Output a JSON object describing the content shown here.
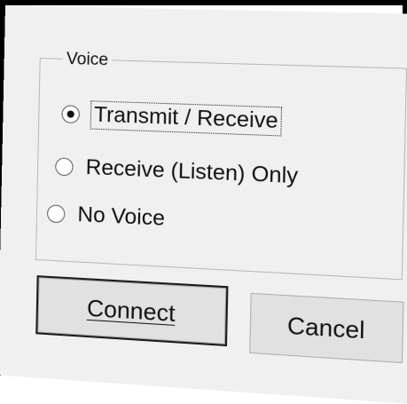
{
  "voice_group": {
    "legend": "Voice",
    "options": [
      {
        "label": "Transmit / Receive",
        "selected": true
      },
      {
        "label": "Receive (Listen) Only",
        "selected": false
      },
      {
        "label": "No Voice",
        "selected": false
      }
    ]
  },
  "buttons": {
    "connect_label": "Connect",
    "cancel_label": "Cancel"
  }
}
